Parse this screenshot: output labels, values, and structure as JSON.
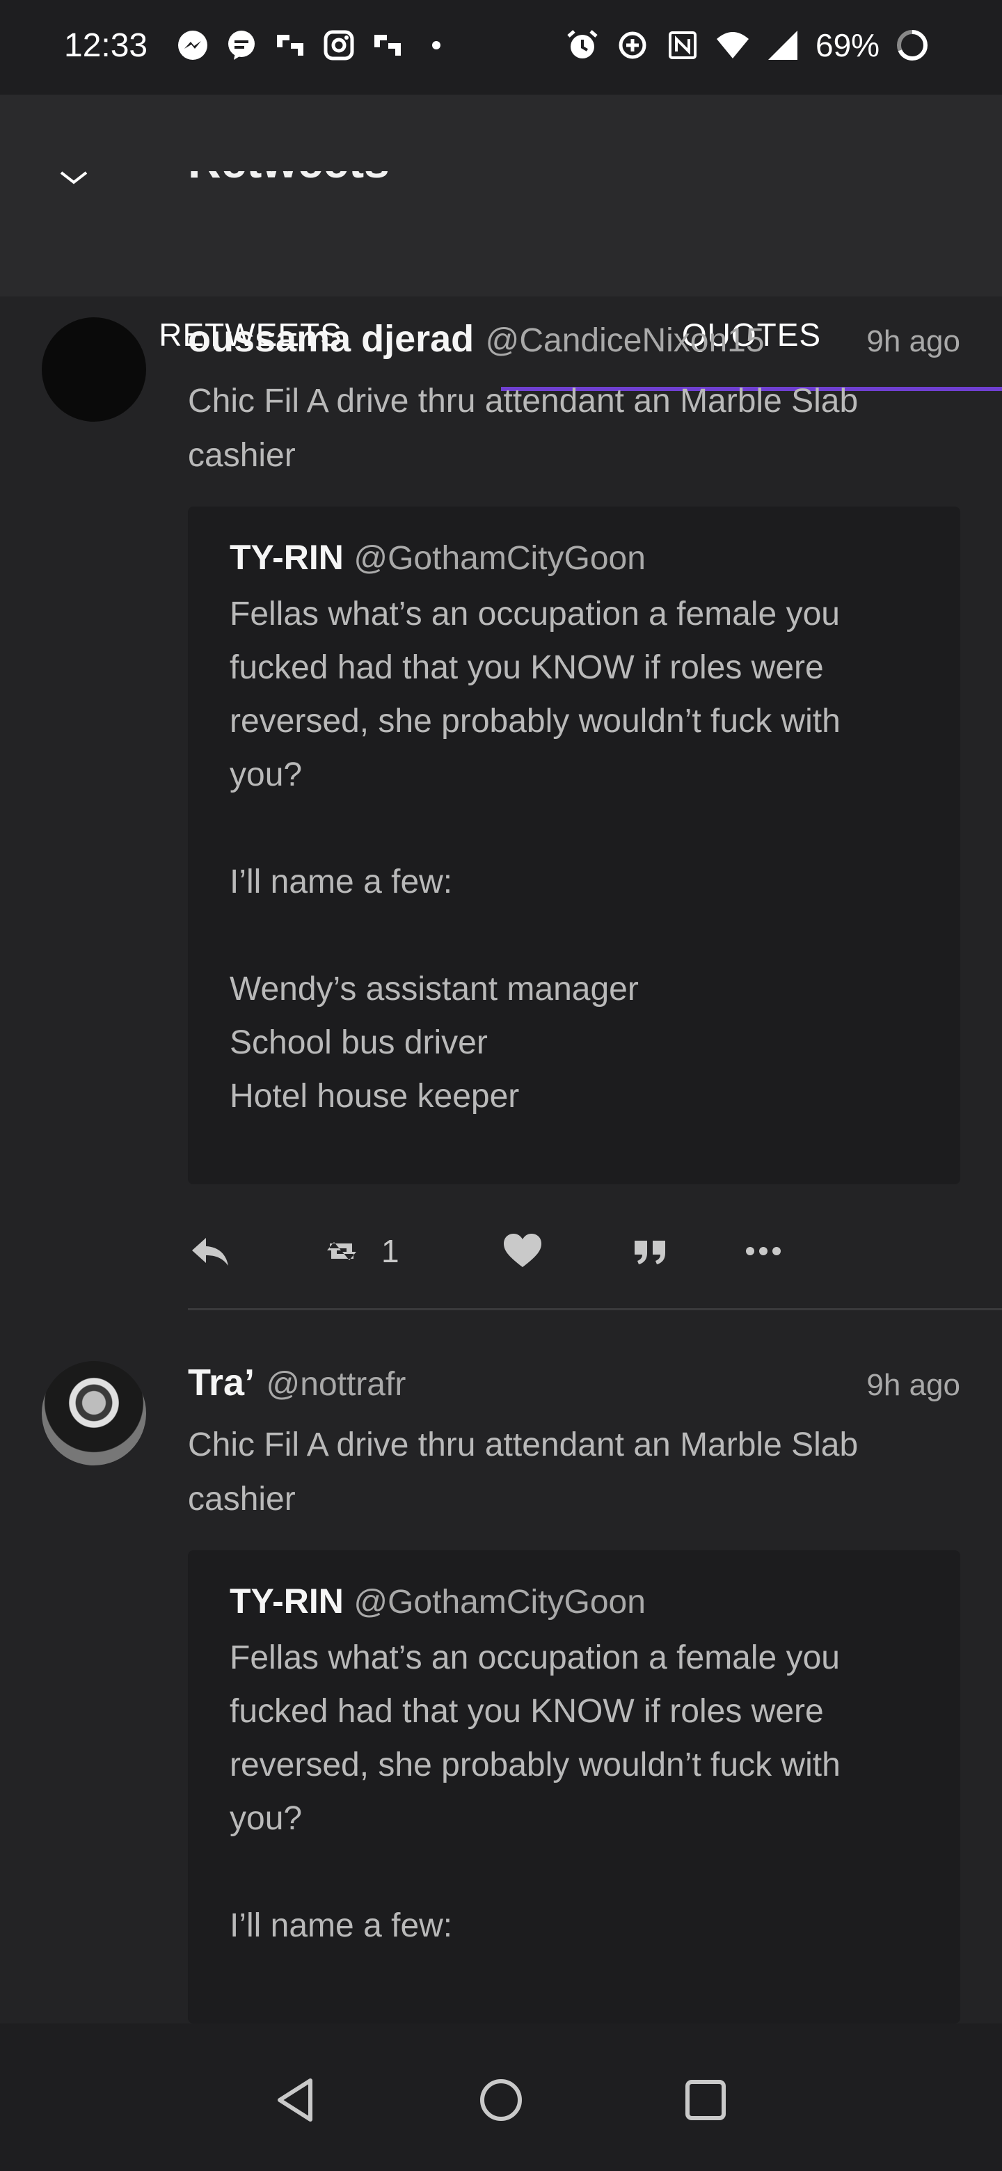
{
  "status_bar": {
    "time": "12:33",
    "battery": "69%",
    "left_icons": [
      "messenger-icon",
      "chat-bubble-icon",
      "slack-like-icon",
      "instagram-icon",
      "slack-like-icon",
      "dot-icon"
    ],
    "right_icons": [
      "alarm-icon",
      "data-saver-icon",
      "nfc-icon",
      "wifi-icon",
      "signal-icon",
      "battery-ring-icon"
    ]
  },
  "header": {
    "title": "Retweets",
    "tabs": [
      {
        "label": "RETWEETS",
        "active": false
      },
      {
        "label": "QUOTES",
        "active": true
      }
    ],
    "accent_color": "#6f3fd1"
  },
  "tweets": [
    {
      "name": "oussama djerad",
      "handle": "@CandiceNixon15",
      "time": "9h ago",
      "text": "Chic Fil A drive thru attendant an Marble Slab cashier",
      "quote": {
        "name": "TY-RIN",
        "handle": "@GothamCityGoon",
        "text": "Fellas what’s an occupation a female you fucked had that you KNOW if roles were reversed, she probably wouldn’t fuck with you?\n\nI’ll name a few:\n\nWendy’s assistant manager\nSchool bus driver\nHotel house keeper"
      },
      "retweet_count": "1"
    },
    {
      "name": "Tra’",
      "handle": "@nottrafr",
      "time": "9h ago",
      "text": "Chic Fil A drive thru attendant an Marble Slab cashier",
      "quote": {
        "name": "TY-RIN",
        "handle": "@GothamCityGoon",
        "text": "Fellas what’s an occupation a female you fucked had that you KNOW if roles were reversed, she probably wouldn’t fuck with you?\n\nI’ll name a few:"
      }
    }
  ]
}
